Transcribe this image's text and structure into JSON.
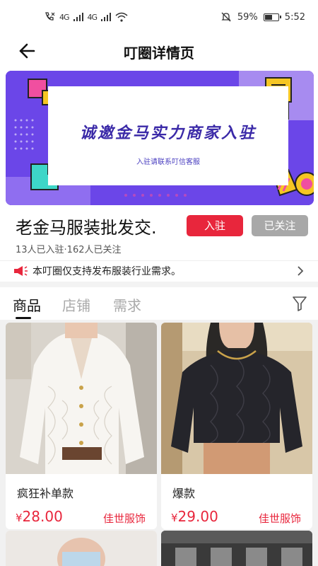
{
  "status_bar": {
    "network_left": "4G",
    "network_right": "4G",
    "battery_percent": "59%",
    "battery_level": 0.59,
    "time": "5:52",
    "icons": [
      "call-icon",
      "signal-icon",
      "signal-icon",
      "wifi-icon",
      "mute-icon",
      "battery-icon"
    ]
  },
  "nav": {
    "title": "叮圈详情页",
    "back_icon": "arrow-left-icon"
  },
  "banner": {
    "title": "诚邀金马实力商家入驻",
    "subtitle": "入驻请联系叮信客服",
    "colors": {
      "background": "#6b46e8",
      "accent_yellow": "#f5c623",
      "accent_pink": "#f04fa0",
      "accent_cyan": "#3dd6c8"
    }
  },
  "circle": {
    "name": "老金马服装批发交.",
    "join_label": "入驻",
    "follow_label": "已关注",
    "stats": "13人已入驻·162人已关注"
  },
  "notice": {
    "text": "本叮圈仅支持发布服装行业需求。",
    "icon": "megaphone-icon"
  },
  "tabs": {
    "items": [
      {
        "label": "商品"
      },
      {
        "label": "店铺"
      },
      {
        "label": "需求"
      }
    ],
    "active": "商品",
    "filter_icon": "filter-icon"
  },
  "products": [
    {
      "name": "疯狂补单款",
      "currency": "¥",
      "price": "28.00",
      "shop": "佳世服饰"
    },
    {
      "name": "爆款",
      "currency": "¥",
      "price": "29.00",
      "shop": "佳世服饰"
    },
    {
      "name": "",
      "currency": "",
      "price": "",
      "shop": ""
    },
    {
      "name": "",
      "currency": "",
      "price": "",
      "shop": ""
    }
  ],
  "colors": {
    "primary_red": "#e8263c",
    "muted_gray": "#a8a8a8"
  }
}
